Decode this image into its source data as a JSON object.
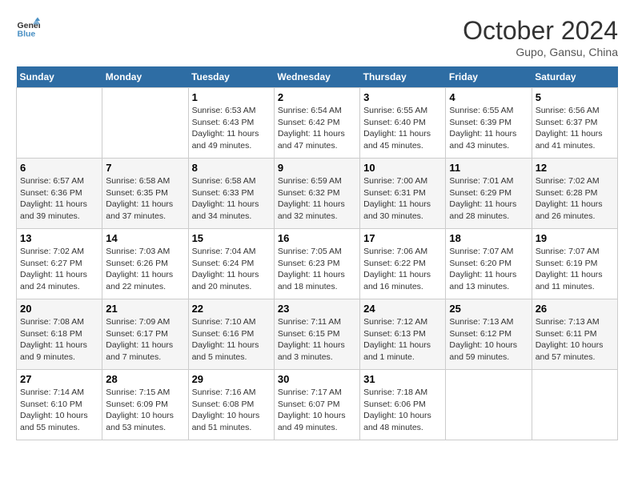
{
  "header": {
    "logo_line1": "General",
    "logo_line2": "Blue",
    "month": "October 2024",
    "location": "Gupo, Gansu, China"
  },
  "weekdays": [
    "Sunday",
    "Monday",
    "Tuesday",
    "Wednesday",
    "Thursday",
    "Friday",
    "Saturday"
  ],
  "weeks": [
    [
      {
        "day": "",
        "sunrise": "",
        "sunset": "",
        "daylight": ""
      },
      {
        "day": "",
        "sunrise": "",
        "sunset": "",
        "daylight": ""
      },
      {
        "day": "1",
        "sunrise": "Sunrise: 6:53 AM",
        "sunset": "Sunset: 6:43 PM",
        "daylight": "Daylight: 11 hours and 49 minutes."
      },
      {
        "day": "2",
        "sunrise": "Sunrise: 6:54 AM",
        "sunset": "Sunset: 6:42 PM",
        "daylight": "Daylight: 11 hours and 47 minutes."
      },
      {
        "day": "3",
        "sunrise": "Sunrise: 6:55 AM",
        "sunset": "Sunset: 6:40 PM",
        "daylight": "Daylight: 11 hours and 45 minutes."
      },
      {
        "day": "4",
        "sunrise": "Sunrise: 6:55 AM",
        "sunset": "Sunset: 6:39 PM",
        "daylight": "Daylight: 11 hours and 43 minutes."
      },
      {
        "day": "5",
        "sunrise": "Sunrise: 6:56 AM",
        "sunset": "Sunset: 6:37 PM",
        "daylight": "Daylight: 11 hours and 41 minutes."
      }
    ],
    [
      {
        "day": "6",
        "sunrise": "Sunrise: 6:57 AM",
        "sunset": "Sunset: 6:36 PM",
        "daylight": "Daylight: 11 hours and 39 minutes."
      },
      {
        "day": "7",
        "sunrise": "Sunrise: 6:58 AM",
        "sunset": "Sunset: 6:35 PM",
        "daylight": "Daylight: 11 hours and 37 minutes."
      },
      {
        "day": "8",
        "sunrise": "Sunrise: 6:58 AM",
        "sunset": "Sunset: 6:33 PM",
        "daylight": "Daylight: 11 hours and 34 minutes."
      },
      {
        "day": "9",
        "sunrise": "Sunrise: 6:59 AM",
        "sunset": "Sunset: 6:32 PM",
        "daylight": "Daylight: 11 hours and 32 minutes."
      },
      {
        "day": "10",
        "sunrise": "Sunrise: 7:00 AM",
        "sunset": "Sunset: 6:31 PM",
        "daylight": "Daylight: 11 hours and 30 minutes."
      },
      {
        "day": "11",
        "sunrise": "Sunrise: 7:01 AM",
        "sunset": "Sunset: 6:29 PM",
        "daylight": "Daylight: 11 hours and 28 minutes."
      },
      {
        "day": "12",
        "sunrise": "Sunrise: 7:02 AM",
        "sunset": "Sunset: 6:28 PM",
        "daylight": "Daylight: 11 hours and 26 minutes."
      }
    ],
    [
      {
        "day": "13",
        "sunrise": "Sunrise: 7:02 AM",
        "sunset": "Sunset: 6:27 PM",
        "daylight": "Daylight: 11 hours and 24 minutes."
      },
      {
        "day": "14",
        "sunrise": "Sunrise: 7:03 AM",
        "sunset": "Sunset: 6:26 PM",
        "daylight": "Daylight: 11 hours and 22 minutes."
      },
      {
        "day": "15",
        "sunrise": "Sunrise: 7:04 AM",
        "sunset": "Sunset: 6:24 PM",
        "daylight": "Daylight: 11 hours and 20 minutes."
      },
      {
        "day": "16",
        "sunrise": "Sunrise: 7:05 AM",
        "sunset": "Sunset: 6:23 PM",
        "daylight": "Daylight: 11 hours and 18 minutes."
      },
      {
        "day": "17",
        "sunrise": "Sunrise: 7:06 AM",
        "sunset": "Sunset: 6:22 PM",
        "daylight": "Daylight: 11 hours and 16 minutes."
      },
      {
        "day": "18",
        "sunrise": "Sunrise: 7:07 AM",
        "sunset": "Sunset: 6:20 PM",
        "daylight": "Daylight: 11 hours and 13 minutes."
      },
      {
        "day": "19",
        "sunrise": "Sunrise: 7:07 AM",
        "sunset": "Sunset: 6:19 PM",
        "daylight": "Daylight: 11 hours and 11 minutes."
      }
    ],
    [
      {
        "day": "20",
        "sunrise": "Sunrise: 7:08 AM",
        "sunset": "Sunset: 6:18 PM",
        "daylight": "Daylight: 11 hours and 9 minutes."
      },
      {
        "day": "21",
        "sunrise": "Sunrise: 7:09 AM",
        "sunset": "Sunset: 6:17 PM",
        "daylight": "Daylight: 11 hours and 7 minutes."
      },
      {
        "day": "22",
        "sunrise": "Sunrise: 7:10 AM",
        "sunset": "Sunset: 6:16 PM",
        "daylight": "Daylight: 11 hours and 5 minutes."
      },
      {
        "day": "23",
        "sunrise": "Sunrise: 7:11 AM",
        "sunset": "Sunset: 6:15 PM",
        "daylight": "Daylight: 11 hours and 3 minutes."
      },
      {
        "day": "24",
        "sunrise": "Sunrise: 7:12 AM",
        "sunset": "Sunset: 6:13 PM",
        "daylight": "Daylight: 11 hours and 1 minute."
      },
      {
        "day": "25",
        "sunrise": "Sunrise: 7:13 AM",
        "sunset": "Sunset: 6:12 PM",
        "daylight": "Daylight: 10 hours and 59 minutes."
      },
      {
        "day": "26",
        "sunrise": "Sunrise: 7:13 AM",
        "sunset": "Sunset: 6:11 PM",
        "daylight": "Daylight: 10 hours and 57 minutes."
      }
    ],
    [
      {
        "day": "27",
        "sunrise": "Sunrise: 7:14 AM",
        "sunset": "Sunset: 6:10 PM",
        "daylight": "Daylight: 10 hours and 55 minutes."
      },
      {
        "day": "28",
        "sunrise": "Sunrise: 7:15 AM",
        "sunset": "Sunset: 6:09 PM",
        "daylight": "Daylight: 10 hours and 53 minutes."
      },
      {
        "day": "29",
        "sunrise": "Sunrise: 7:16 AM",
        "sunset": "Sunset: 6:08 PM",
        "daylight": "Daylight: 10 hours and 51 minutes."
      },
      {
        "day": "30",
        "sunrise": "Sunrise: 7:17 AM",
        "sunset": "Sunset: 6:07 PM",
        "daylight": "Daylight: 10 hours and 49 minutes."
      },
      {
        "day": "31",
        "sunrise": "Sunrise: 7:18 AM",
        "sunset": "Sunset: 6:06 PM",
        "daylight": "Daylight: 10 hours and 48 minutes."
      },
      {
        "day": "",
        "sunrise": "",
        "sunset": "",
        "daylight": ""
      },
      {
        "day": "",
        "sunrise": "",
        "sunset": "",
        "daylight": ""
      }
    ]
  ]
}
